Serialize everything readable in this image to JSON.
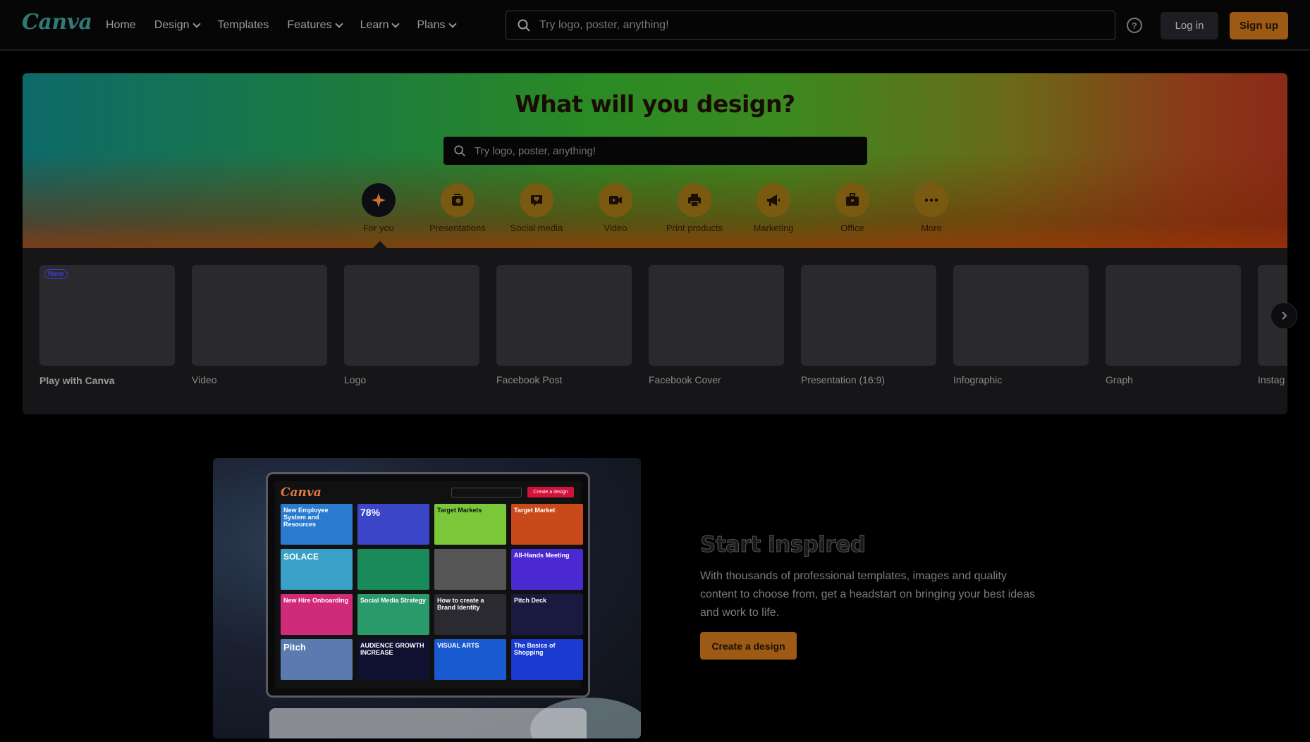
{
  "brand": {
    "logo_text": "Canva",
    "accent": "#9c5a15"
  },
  "nav": {
    "items": [
      {
        "label": "Home",
        "dropdown": false
      },
      {
        "label": "Design",
        "dropdown": true
      },
      {
        "label": "Templates",
        "dropdown": false
      },
      {
        "label": "Features",
        "dropdown": true
      },
      {
        "label": "Learn",
        "dropdown": true
      },
      {
        "label": "Plans",
        "dropdown": true
      }
    ]
  },
  "top_search": {
    "placeholder": "Try logo, poster, anything!"
  },
  "header_actions": {
    "help_icon": "?",
    "login": "Log in",
    "signup": "Sign up"
  },
  "hero": {
    "title": "What will you design?",
    "search_placeholder": "Try logo, poster, anything!",
    "categories": [
      {
        "label": "For you",
        "icon": "sparkle-icon",
        "active": true
      },
      {
        "label": "Presentations",
        "icon": "presentation-icon",
        "active": false
      },
      {
        "label": "Social media",
        "icon": "heart-chat-icon",
        "active": false
      },
      {
        "label": "Video",
        "icon": "video-icon",
        "active": false
      },
      {
        "label": "Print products",
        "icon": "printer-icon",
        "active": false
      },
      {
        "label": "Marketing",
        "icon": "megaphone-icon",
        "active": false
      },
      {
        "label": "Office",
        "icon": "briefcase-icon",
        "active": false
      },
      {
        "label": "More",
        "icon": "more-icon",
        "active": false
      }
    ]
  },
  "carousel": {
    "items": [
      {
        "label": "Play with Canva",
        "badge": "New"
      },
      {
        "label": "Video"
      },
      {
        "label": "Logo"
      },
      {
        "label": "Facebook Post"
      },
      {
        "label": "Facebook Cover"
      },
      {
        "label": "Presentation (16:9)"
      },
      {
        "label": "Infographic"
      },
      {
        "label": "Graph"
      },
      {
        "label": "Instag"
      }
    ]
  },
  "laptop_screen": {
    "logo": "Canva",
    "button": "Create a design",
    "tiles": [
      "New Employee System and Resources",
      "78%",
      "Target Markets",
      "Target Market",
      "SOLACE",
      "",
      "",
      "All-Hands Meeting",
      "New Hire Onboarding",
      "Social Media Strategy",
      "How to create a Brand Identity",
      "Pitch Deck",
      "Pitch",
      "AUDIENCE GROWTH INCREASE",
      "VISUAL ARTS",
      "The Basics of Shopping"
    ]
  },
  "inspired": {
    "title": "Start inspired",
    "text": "With thousands of professional templates, images and quality content to choose from, get a headstart on bringing your best ideas and work to life.",
    "button": "Create a design"
  }
}
